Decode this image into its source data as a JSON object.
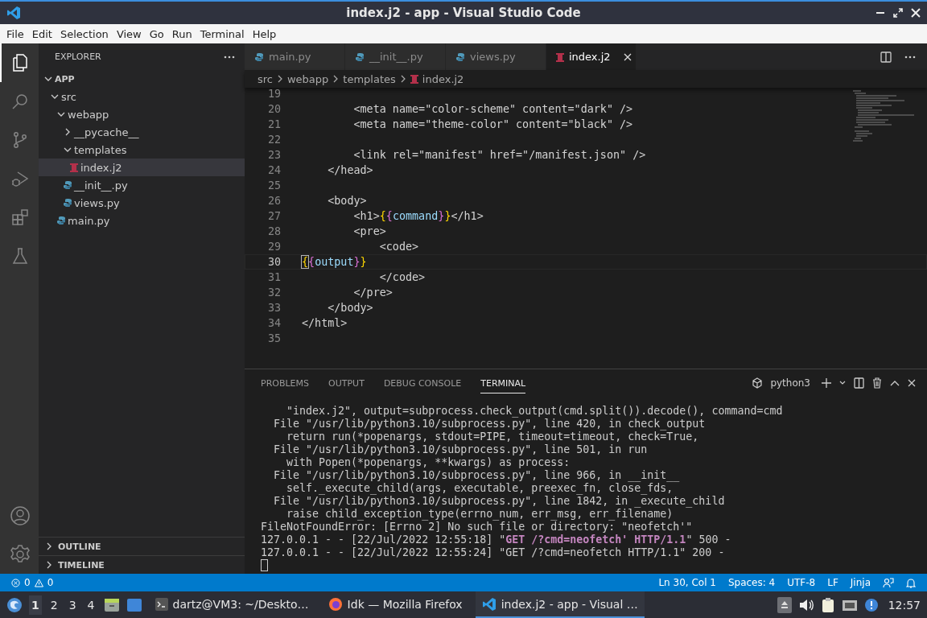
{
  "window": {
    "title": "index.j2 - app - Visual Studio Code"
  },
  "menu": [
    "File",
    "Edit",
    "Selection",
    "View",
    "Go",
    "Run",
    "Terminal",
    "Help"
  ],
  "activity_bar": {
    "items": [
      {
        "kind": "explorer",
        "selected": true
      },
      {
        "kind": "search",
        "selected": false
      },
      {
        "kind": "source-control",
        "selected": false
      },
      {
        "kind": "run-debug",
        "selected": false
      },
      {
        "kind": "extensions",
        "selected": false
      },
      {
        "kind": "testing",
        "selected": false
      }
    ],
    "bottom": [
      {
        "kind": "account"
      },
      {
        "kind": "settings"
      }
    ]
  },
  "sidebar": {
    "title": "EXPLORER",
    "tree": [
      {
        "label": "APP",
        "kind": "root",
        "expanded": true,
        "selected": false,
        "children": [
          {
            "label": "src",
            "kind": "folder",
            "expanded": true,
            "selected": false,
            "children": [
              {
                "label": "webapp",
                "kind": "folder",
                "expanded": true,
                "selected": false,
                "children": [
                  {
                    "label": "__pycache__",
                    "kind": "folder",
                    "expanded": false,
                    "selected": false
                  },
                  {
                    "label": "templates",
                    "kind": "folder",
                    "expanded": true,
                    "selected": false,
                    "children": [
                      {
                        "label": "index.j2",
                        "kind": "jinja",
                        "selected": true
                      }
                    ]
                  },
                  {
                    "label": "__init__.py",
                    "kind": "python",
                    "selected": false
                  },
                  {
                    "label": "views.py",
                    "kind": "python",
                    "selected": false
                  }
                ]
              },
              {
                "label": "main.py",
                "kind": "python",
                "selected": false
              }
            ]
          }
        ]
      }
    ],
    "sections": [
      {
        "label": "OUTLINE",
        "expanded": false
      },
      {
        "label": "TIMELINE",
        "expanded": false
      }
    ]
  },
  "editor": {
    "tabs": [
      {
        "label": "main.py",
        "kind": "python",
        "selected": false
      },
      {
        "label": "__init__.py",
        "kind": "python",
        "selected": false
      },
      {
        "label": "views.py",
        "kind": "python",
        "selected": false
      },
      {
        "label": "index.j2",
        "kind": "jinja",
        "selected": true
      }
    ],
    "breadcrumb": [
      {
        "label": "src",
        "kind": "folder"
      },
      {
        "label": "webapp",
        "kind": "folder"
      },
      {
        "label": "templates",
        "kind": "folder"
      },
      {
        "label": "index.j2",
        "kind": "jinja"
      }
    ],
    "lines": [
      {
        "number": "19",
        "current": false
      },
      {
        "number": "20",
        "current": false,
        "tokens": [
          {
            "kind": "text",
            "text": "        <meta name=\"color-scheme\" content=\"dark\" />"
          }
        ]
      },
      {
        "number": "21",
        "current": false,
        "tokens": [
          {
            "kind": "text",
            "text": "        <meta name=\"theme-color\" content=\"black\" />"
          }
        ]
      },
      {
        "number": "22",
        "current": false
      },
      {
        "number": "23",
        "current": false,
        "tokens": [
          {
            "kind": "text",
            "text": "        <link rel=\"manifest\" href=\"/manifest.json\" />"
          }
        ]
      },
      {
        "number": "24",
        "current": false,
        "tokens": [
          {
            "kind": "text",
            "text": "    </head>"
          }
        ]
      },
      {
        "number": "25",
        "current": false
      },
      {
        "number": "26",
        "current": false,
        "tokens": [
          {
            "kind": "text",
            "text": "    <body>"
          }
        ]
      },
      {
        "number": "27",
        "current": false,
        "tokens": [
          {
            "kind": "text",
            "text": "        <h1>"
          },
          {
            "kind": "bracket1",
            "text": "{"
          },
          {
            "kind": "bracket2",
            "text": "{"
          },
          {
            "kind": "variable",
            "text": "command"
          },
          {
            "kind": "bracket2",
            "text": "}"
          },
          {
            "kind": "bracket1",
            "text": "}"
          },
          {
            "kind": "text",
            "text": "</h1>"
          }
        ]
      },
      {
        "number": "28",
        "current": false,
        "tokens": [
          {
            "kind": "text",
            "text": "        <pre>"
          }
        ]
      },
      {
        "number": "29",
        "current": false,
        "tokens": [
          {
            "kind": "text",
            "text": "            <code>"
          }
        ]
      },
      {
        "number": "30",
        "current": true,
        "tokens": [
          {
            "kind": "bracket1",
            "text": "{"
          },
          {
            "kind": "bracket2",
            "text": "{"
          },
          {
            "kind": "variable",
            "text": "output"
          },
          {
            "kind": "bracket2",
            "text": "}"
          },
          {
            "kind": "bracket1",
            "text": "}"
          }
        ]
      },
      {
        "number": "31",
        "current": false,
        "tokens": [
          {
            "kind": "text",
            "text": "            </code>"
          }
        ]
      },
      {
        "number": "32",
        "current": false,
        "tokens": [
          {
            "kind": "text",
            "text": "        </pre>"
          }
        ]
      },
      {
        "number": "33",
        "current": false,
        "tokens": [
          {
            "kind": "text",
            "text": "    </body>"
          }
        ]
      },
      {
        "number": "34",
        "current": false,
        "tokens": [
          {
            "kind": "text",
            "text": "</html>"
          }
        ]
      },
      {
        "number": "35",
        "current": false
      }
    ]
  },
  "panel": {
    "tabs": [
      {
        "label": "PROBLEMS",
        "selected": false
      },
      {
        "label": "OUTPUT",
        "selected": false
      },
      {
        "label": "DEBUG CONSOLE",
        "selected": false
      },
      {
        "label": "TERMINAL",
        "selected": true
      }
    ],
    "terminal_name": "python3",
    "lines": [
      "    \"index.j2\", output=subprocess.check_output(cmd.split()).decode(), command=cmd",
      "  File \"/usr/lib/python3.10/subprocess.py\", line 420, in check_output",
      "    return run(*popenargs, stdout=PIPE, timeout=timeout, check=True,",
      "  File \"/usr/lib/python3.10/subprocess.py\", line 501, in run",
      "    with Popen(*popenargs, **kwargs) as process:",
      "  File \"/usr/lib/python3.10/subprocess.py\", line 966, in __init__",
      "    self._execute_child(args, executable, preexec_fn, close_fds,",
      "  File \"/usr/lib/python3.10/subprocess.py\", line 1842, in _execute_child",
      "    raise child_exception_type(errno_num, err_msg, err_filename)",
      "FileNotFoundError: [Errno 2] No such file or directory: \"neofetch'\"",
      "127.0.0.1 - - [22/Jul/2022 12:55:18] \"**GET /?cmd=neofetch' HTTP/1.1**\" 500 -",
      "127.0.0.1 - - [22/Jul/2022 12:55:24] \"GET /?cmd=neofetch HTTP/1.1\" 200 -"
    ]
  },
  "status_bar": {
    "errors": "0",
    "warnings": "0",
    "items": [
      "Ln 30, Col 1",
      "Spaces: 4",
      "UTF-8",
      "LF",
      "Jinja"
    ]
  },
  "taskbar": {
    "workspaces": [
      {
        "label": "1",
        "selected": true
      },
      {
        "label": "2",
        "selected": false
      },
      {
        "label": "3",
        "selected": false
      },
      {
        "label": "4",
        "selected": false
      }
    ],
    "tasks": [
      {
        "kind": "terminal",
        "label": "dartz@VM3: ~/Deskto…",
        "selected": false
      },
      {
        "kind": "firefox",
        "label": "Idk — Mozilla Firefox",
        "selected": false
      },
      {
        "kind": "vscode",
        "label": "index.j2 - app - Visual …",
        "selected": true
      }
    ],
    "clock": "12:57"
  }
}
